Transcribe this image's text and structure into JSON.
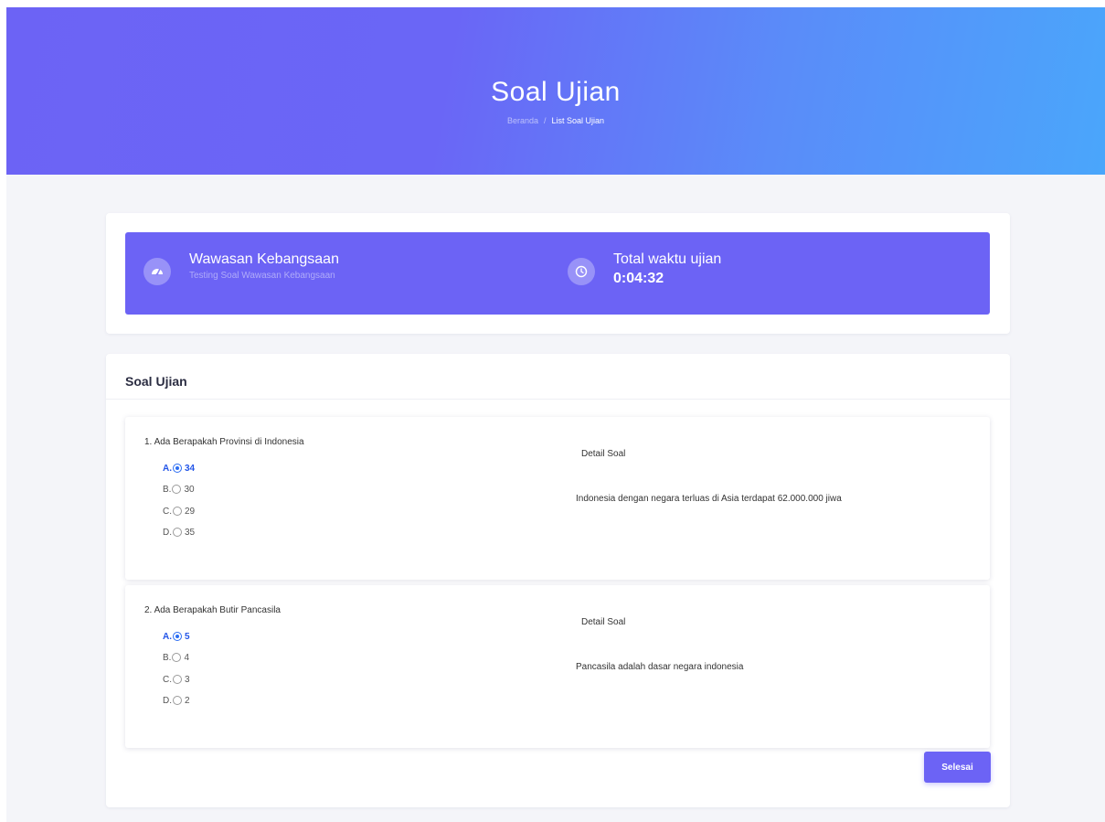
{
  "hero": {
    "title": "Soal Ujian",
    "breadcrumb": {
      "home": "Beranda",
      "separator": "/",
      "current": "List Soal Ujian"
    },
    "gradient": [
      "#6c63f5",
      "#4aa6fb"
    ]
  },
  "exam": {
    "icon": "dashboard-icon",
    "title": "Wawasan Kebangsaan",
    "subtitle": "Testing Soal Wawasan Kebangsaan",
    "timer_icon": "clock-icon",
    "timer_label": "Total waktu ujian",
    "timer_value": "0:04:32",
    "banner_color": "#6c63f5"
  },
  "main": {
    "title": "Soal Ujian",
    "questions": [
      {
        "text": "1. Ada Berapakah Provinsi di Indonesia",
        "options": [
          {
            "letter": "A.",
            "value": "34",
            "selected": true
          },
          {
            "letter": "B.",
            "value": "30",
            "selected": false
          },
          {
            "letter": "C.",
            "value": "29",
            "selected": false
          },
          {
            "letter": "D.",
            "value": "35",
            "selected": false
          }
        ],
        "detail_label": "Detail Soal",
        "detail_text": "Indonesia dengan negara terluas di Asia terdapat 62.000.000 jiwa"
      },
      {
        "text": "2. Ada Berapakah Butir Pancasila",
        "options": [
          {
            "letter": "A.",
            "value": "5",
            "selected": true
          },
          {
            "letter": "B.",
            "value": "4",
            "selected": false
          },
          {
            "letter": "C.",
            "value": "3",
            "selected": false
          },
          {
            "letter": "D.",
            "value": "2",
            "selected": false
          }
        ],
        "detail_label": "Detail Soal",
        "detail_text": "Pancasila adalah dasar negara indonesia"
      }
    ],
    "finish_label": "Selesai",
    "selected_color": "#2456e8"
  }
}
